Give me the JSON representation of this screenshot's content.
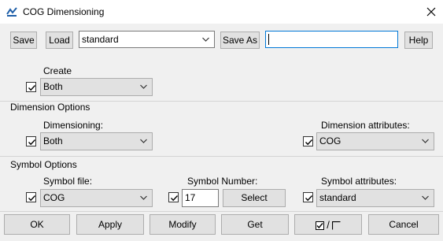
{
  "window": {
    "title": "COG Dimensioning",
    "icon": "app-logo-icon",
    "close_icon": "close-icon"
  },
  "toolbar": {
    "save_label": "Save",
    "load_label": "Load",
    "preset_value": "standard",
    "save_as_label": "Save As",
    "save_as_value": "",
    "help_label": "Help"
  },
  "create": {
    "label": "Create",
    "checked": true,
    "value": "Both"
  },
  "dimension_options": {
    "title": "Dimension Options",
    "dimensioning_label": "Dimensioning:",
    "dimensioning_checked": true,
    "dimensioning_value": "Both",
    "attributes_label": "Dimension attributes:",
    "attributes_checked": true,
    "attributes_value": "COG"
  },
  "symbol_options": {
    "title": "Symbol Options",
    "file_label": "Symbol file:",
    "file_checked": true,
    "file_value": "COG",
    "number_label": "Symbol Number:",
    "number_checked": true,
    "number_value": "17",
    "select_label": "Select",
    "attributes_label": "Symbol attributes:",
    "attributes_checked": true,
    "attributes_value": "standard"
  },
  "footer": {
    "ok_label": "OK",
    "apply_label": "Apply",
    "modify_label": "Modify",
    "get_label": "Get",
    "toggle_label": "/",
    "cancel_label": "Cancel"
  },
  "colors": {
    "accent": "#0078d7",
    "background": "#f0f0f0",
    "button": "#e1e1e1"
  }
}
